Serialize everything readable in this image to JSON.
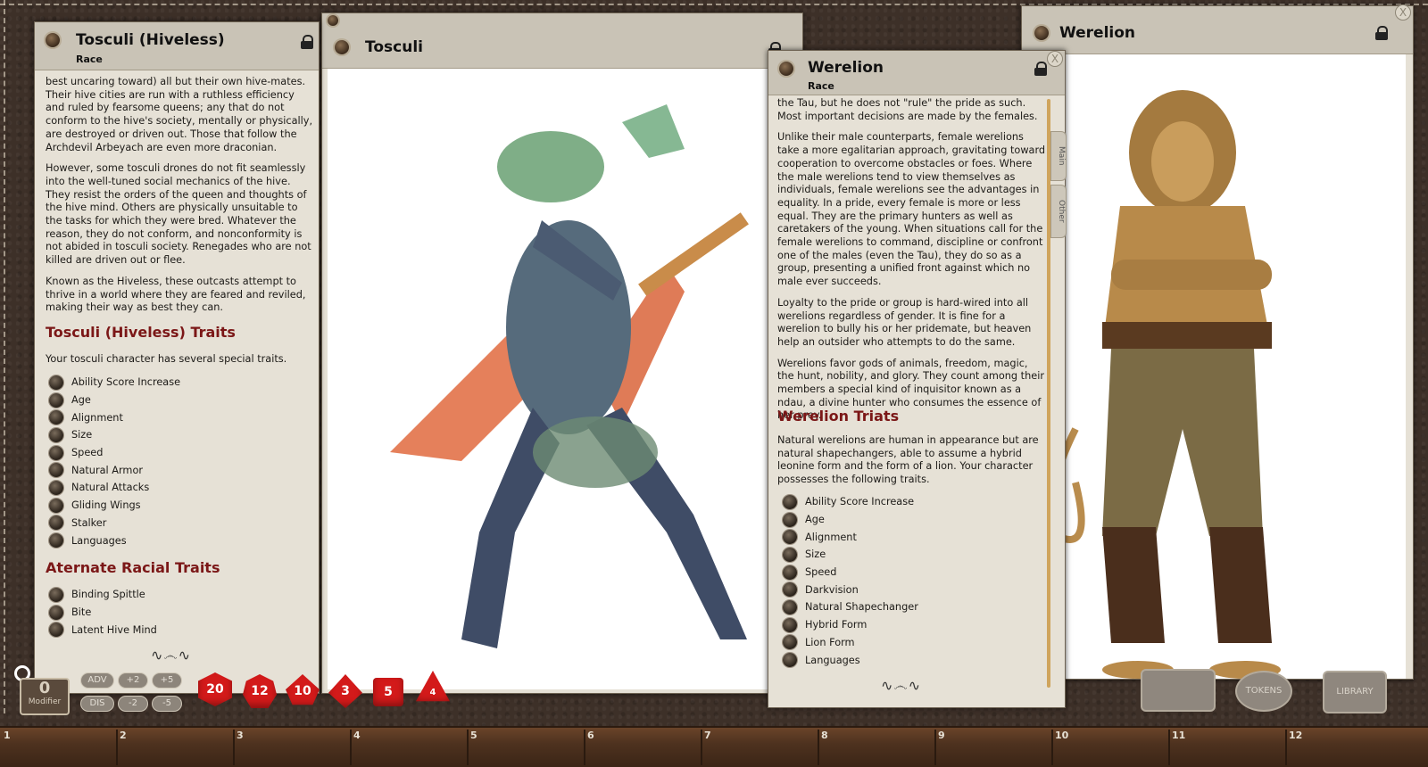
{
  "windows": {
    "tosculi_hiveless": {
      "title": "Tosculi (Hiveless)",
      "subtitle": "Race",
      "paragraphs": [
        "best uncaring toward) all but their own hive-mates. Their hive cities are run with a ruthless efficiency and ruled by fearsome queens; any that do not conform to the hive's society, mentally or physically, are destroyed or driven out. Those that follow the Archdevil Arbeyach are even more draconian.",
        "However, some tosculi drones do not fit seamlessly into the well-tuned social mechanics of the hive. They resist the orders of the queen and thoughts of the hive mind. Others are physically unsuitable to the tasks for which they were bred. Whatever the reason, they do not conform, and nonconformity is not abided in tosculi society. Renegades who are not killed are driven out or flee.",
        "Known as the Hiveless, these outcasts attempt to thrive in a world where they are feared and reviled, making their way as best they can."
      ],
      "traits_heading": "Tosculi (Hiveless) Traits",
      "traits_intro": "Your tosculi character has several special traits.",
      "traits": [
        "Ability Score Increase",
        "Age",
        "Alignment",
        "Size",
        "Speed",
        "Natural Armor",
        "Natural Attacks",
        "Gliding Wings",
        "Stalker",
        "Languages"
      ],
      "alt_heading": "Aternate Racial Traits",
      "alt_traits": [
        "Binding Spittle",
        "Bite",
        "Latent Hive Mind"
      ],
      "flourish": "∿෴∿"
    },
    "tosculi_image": {
      "title": "Tosculi"
    },
    "werelion": {
      "title": "Werelion",
      "subtitle": "Race",
      "paragraphs": [
        "the Tau, but he does not \"rule\" the pride as such. Most important decisions are made by the females.",
        "Unlike their male counterparts, female werelions take a more egalitarian approach, gravitating toward cooperation to overcome obstacles or foes. Where the male werelions tend to view themselves as individuals, female werelions see the advantages in equality. In a pride, every female is more or less equal. They are the primary hunters as well as caretakers of the young. When situations call for the female werelions to command, discipline or confront one of the males (even the Tau), they do so as a group, presenting a unified front against which no male ever succeeds.",
        "Loyalty to the pride or group is hard-wired into all werelions regardless of gender. It is fine for a werelion to bully his or her pridemate, but heaven help an outsider who attempts to do the same.",
        "Werelions favor gods of animals, freedom, magic, the hunt, nobility, and glory. They count among their members a special kind of inquisitor known as a ndau, a divine hunter who consumes the essence of her prey."
      ],
      "traits_heading": "Werelion Triats",
      "traits_intro": "Natural werelions are human in appearance but are natural shapechangers, able to assume a hybrid leonine form and the form of a lion. Your character possesses the following traits.",
      "traits": [
        "Ability Score Increase",
        "Age",
        "Alignment",
        "Size",
        "Speed",
        "Darkvision",
        "Natural Shapechanger",
        "Hybrid Form",
        "Lion Form",
        "Languages"
      ],
      "tabs": [
        "Main",
        "Other"
      ],
      "close_label": "X",
      "flourish": "∿෴∿"
    },
    "werelion_image": {
      "title": "Werelion",
      "close_label": "X"
    }
  },
  "modifier": {
    "value": "0",
    "label": "Modifier"
  },
  "adv_buttons": [
    "ADV",
    "+2",
    "+5",
    "DIS",
    "-2",
    "-5"
  ],
  "dice": [
    {
      "sides": "d20",
      "label": "20",
      "shape": "icosa"
    },
    {
      "sides": "d12",
      "label": "12",
      "shape": "dodeca"
    },
    {
      "sides": "d10",
      "label": "10",
      "shape": "deca"
    },
    {
      "sides": "d8",
      "label": "3",
      "shape": "octa"
    },
    {
      "sides": "d6",
      "label": "5",
      "shape": "cube"
    },
    {
      "sides": "d4",
      "label": "4",
      "shape": "tetra"
    }
  ],
  "side_buttons": [
    "",
    "TOKENS",
    "LIBRARY"
  ],
  "hotbar": [
    "1",
    "2",
    "3",
    "4",
    "5",
    "6",
    "7",
    "8",
    "9",
    "10",
    "11",
    "12"
  ],
  "colors": {
    "heading_red": "#7b1717",
    "panel": "#e6e1d6",
    "hotbar": "#4e321f",
    "dice_red": "#d31a1a"
  }
}
